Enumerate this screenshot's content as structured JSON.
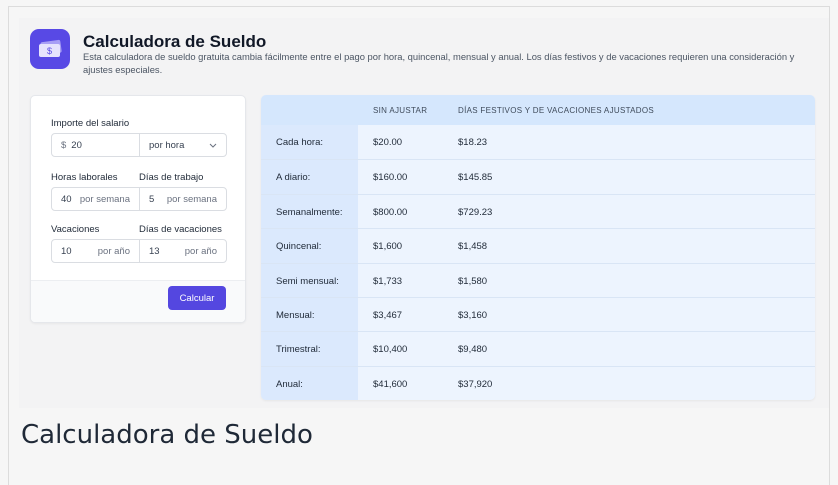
{
  "header": {
    "title": "Calculadora de Sueldo",
    "subtitle": "Esta calculadora de sueldo gratuita cambia fácilmente entre el pago por hora, quincenal, mensual y anual. Los días festivos y de vacaciones requieren una consideración y ajustes especiales.",
    "logo_glyph": "$"
  },
  "form": {
    "salary_label": "Importe del salario",
    "currency_symbol": "$",
    "salary_value": "20",
    "period_value": "por hora",
    "hours_label": "Horas laborales",
    "hours_value": "40",
    "hours_unit": "por semana",
    "days_label": "Días de trabajo",
    "days_value": "5",
    "days_unit": "por semana",
    "vacation_label": "Vacaciones",
    "vacation_value": "10",
    "vacation_unit": "por año",
    "vacation_days_label": "Días de vacaciones",
    "vacation_days_value": "13",
    "vacation_days_unit": "por año",
    "calculate_label": "Calcular"
  },
  "table": {
    "headers": [
      "",
      "SIN AJUSTAR",
      "DÍAS FESTIVOS Y DE VACACIONES AJUSTADOS"
    ],
    "rows": [
      {
        "label": "Cada hora:",
        "unadjusted": "$20.00",
        "adjusted": "$18.23"
      },
      {
        "label": "A diario:",
        "unadjusted": "$160.00",
        "adjusted": "$145.85"
      },
      {
        "label": "Semanalmente:",
        "unadjusted": "$800.00",
        "adjusted": "$729.23"
      },
      {
        "label": "Quincenal:",
        "unadjusted": "$1,600",
        "adjusted": "$1,458"
      },
      {
        "label": "Semi mensual:",
        "unadjusted": "$1,733",
        "adjusted": "$1,580"
      },
      {
        "label": "Mensual:",
        "unadjusted": "$3,467",
        "adjusted": "$3,160"
      },
      {
        "label": "Trimestral:",
        "unadjusted": "$10,400",
        "adjusted": "$9,480"
      },
      {
        "label": "Anual:",
        "unadjusted": "$41,600",
        "adjusted": "$37,920"
      }
    ]
  },
  "caption": "Calculadora de Sueldo",
  "colors": {
    "accent": "#5447e0",
    "table_header": "#d5e7fd",
    "table_body": "#edf4fe"
  }
}
